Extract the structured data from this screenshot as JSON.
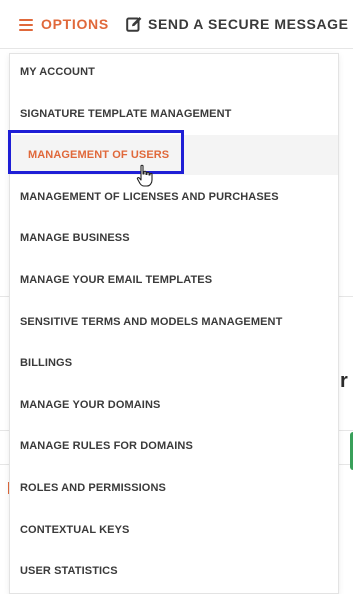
{
  "topbar": {
    "options_label": "OPTIONS",
    "secure_message_label": "SEND A SECURE MESSAGE"
  },
  "menu": {
    "items": [
      {
        "label": "MY ACCOUNT"
      },
      {
        "label": "SIGNATURE TEMPLATE MANAGEMENT"
      },
      {
        "label": "MANAGEMENT OF USERS",
        "active": true
      },
      {
        "label": "MANAGEMENT OF LICENSES AND PURCHASES"
      },
      {
        "label": "MANAGE BUSINESS"
      },
      {
        "label": "MANAGE YOUR EMAIL TEMPLATES"
      },
      {
        "label": "SENSITIVE TERMS AND MODELS MANAGEMENT"
      },
      {
        "label": "BILLINGS"
      },
      {
        "label": "MANAGE YOUR DOMAINS"
      },
      {
        "label": "MANAGE RULES FOR DOMAINS"
      },
      {
        "label": "ROLES AND PERMISSIONS"
      },
      {
        "label": "CONTEXTUAL KEYS"
      },
      {
        "label": "USER STATISTICS"
      }
    ]
  },
  "background": {
    "partial_letter": "r"
  },
  "colors": {
    "accent": "#e0683a",
    "text": "#3a3a3a",
    "highlight_border": "#1f1fd6",
    "active_bg": "#f4f4f4"
  },
  "icons": {
    "options": "hamburger-icon",
    "secure_message": "edit-icon",
    "pointer": "hand-cursor-icon"
  }
}
